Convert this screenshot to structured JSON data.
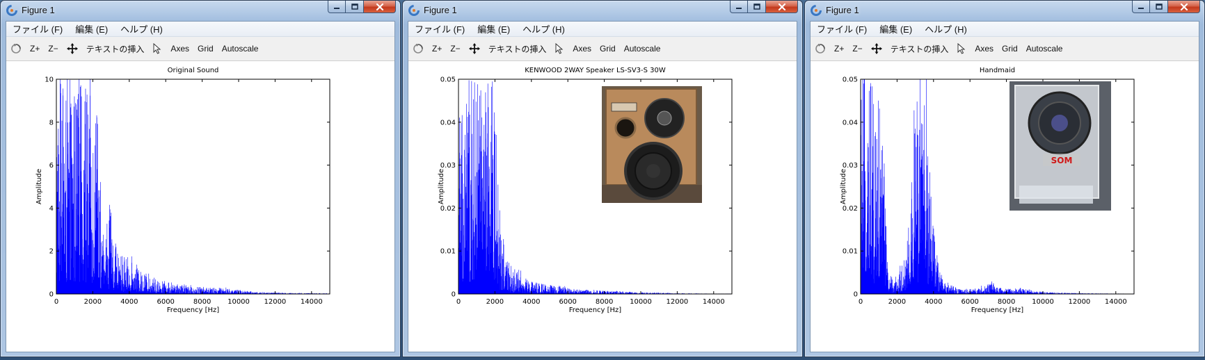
{
  "windows": [
    {
      "title": "Figure 1",
      "menu": [
        "ファイル (F)",
        "編集 (E)",
        "ヘルプ (H)"
      ],
      "toolbar": {
        "zoom_in": "Z+",
        "zoom_out": "Z−",
        "insert_text": "テキストの挿入",
        "axes": "Axes",
        "grid": "Grid",
        "autoscale": "Autoscale"
      },
      "chart_data": {
        "type": "line",
        "title": "Original Sound",
        "xlabel": "Frequency [Hz]",
        "ylabel": "Amplitude",
        "xlim": [
          0,
          15000
        ],
        "ylim": [
          0,
          10
        ],
        "xticks": [
          "0",
          "2000",
          "4000",
          "6000",
          "8000",
          "10000",
          "12000",
          "14000"
        ],
        "yticks": [
          "0",
          "2",
          "4",
          "6",
          "8",
          "10"
        ],
        "color": "#0000ff",
        "envelope": {
          "x": [
            0,
            100,
            300,
            500,
            700,
            900,
            1100,
            1300,
            1500,
            1700,
            1900,
            2100,
            2300,
            2500,
            2700,
            2900,
            3100,
            3300,
            3600,
            4000,
            4500,
            5000,
            5500,
            6000,
            6500,
            7000,
            7500,
            8000,
            8500,
            9000,
            9500,
            10000,
            11000,
            12000,
            13000,
            14000,
            15000
          ],
          "y": [
            10,
            10,
            10,
            10,
            10,
            10,
            10,
            10,
            10,
            10,
            9.5,
            10,
            7.5,
            3.0,
            3.5,
            4.4,
            2.5,
            2.0,
            1.9,
            1.6,
            1.1,
            1.0,
            0.7,
            0.6,
            0.45,
            0.45,
            0.35,
            0.35,
            0.3,
            0.3,
            0.25,
            0.2,
            0.1,
            0.07,
            0.05,
            0.04,
            0.03
          ]
        },
        "inset": null
      }
    },
    {
      "title": "Figure 1",
      "menu": [
        "ファイル (F)",
        "編集 (E)",
        "ヘルプ (H)"
      ],
      "toolbar": {
        "zoom_in": "Z+",
        "zoom_out": "Z−",
        "insert_text": "テキストの挿入",
        "axes": "Axes",
        "grid": "Grid",
        "autoscale": "Autoscale"
      },
      "chart_data": {
        "type": "line",
        "title": "KENWOOD 2WAY Speaker LS-SV3-S 30W",
        "xlabel": "Frequency [Hz]",
        "ylabel": "Amplitude",
        "xlim": [
          0,
          15000
        ],
        "ylim": [
          0,
          0.05
        ],
        "xticks": [
          "0",
          "2000",
          "4000",
          "6000",
          "8000",
          "10000",
          "12000",
          "14000"
        ],
        "yticks": [
          "0",
          "0.01",
          "0.02",
          "0.03",
          "0.04",
          "0.05"
        ],
        "color": "#0000ff",
        "envelope": {
          "x": [
            0,
            100,
            300,
            500,
            700,
            900,
            1100,
            1300,
            1500,
            1700,
            1900,
            2100,
            2300,
            2500,
            2700,
            2900,
            3100,
            3300,
            3600,
            4000,
            4500,
            5000,
            5500,
            6000,
            6500,
            7000,
            7500,
            8000,
            8500,
            9000,
            9500,
            10000,
            11000,
            12000,
            13000,
            14000,
            15000
          ],
          "y": [
            0.05,
            0.05,
            0.05,
            0.05,
            0.05,
            0.05,
            0.05,
            0.05,
            0.05,
            0.05,
            0.05,
            0.03,
            0.018,
            0.012,
            0.008,
            0.007,
            0.006,
            0.005,
            0.004,
            0.003,
            0.0025,
            0.002,
            0.0018,
            0.0015,
            0.0012,
            0.001,
            0.0009,
            0.0008,
            0.0007,
            0.0006,
            0.0005,
            0.0004,
            0.0003,
            0.0002,
            0.00015,
            0.0001,
            0.0001
          ]
        },
        "inset": {
          "name": "kenwood-speaker-photo"
        }
      }
    },
    {
      "title": "Figure 1",
      "menu": [
        "ファイル (F)",
        "編集 (E)",
        "ヘルプ (H)"
      ],
      "toolbar": {
        "zoom_in": "Z+",
        "zoom_out": "Z−",
        "insert_text": "テキストの挿入",
        "axes": "Axes",
        "grid": "Grid",
        "autoscale": "Autoscale"
      },
      "chart_data": {
        "type": "line",
        "title": "Handmaid",
        "xlabel": "Frequency [Hz]",
        "ylabel": "Amplitude",
        "xlim": [
          0,
          15000
        ],
        "ylim": [
          0,
          0.05
        ],
        "xticks": [
          "0",
          "2000",
          "4000",
          "6000",
          "8000",
          "10000",
          "12000",
          "14000"
        ],
        "yticks": [
          "0",
          "0.01",
          "0.02",
          "0.03",
          "0.04",
          "0.05"
        ],
        "color": "#0000ff",
        "envelope": {
          "x": [
            0,
            100,
            300,
            500,
            700,
            900,
            1100,
            1300,
            1500,
            1700,
            1900,
            2100,
            2300,
            2500,
            2700,
            2900,
            3100,
            3300,
            3500,
            3700,
            3900,
            4100,
            4300,
            4600,
            5000,
            5500,
            6000,
            6500,
            7000,
            7200,
            7500,
            8000,
            8500,
            9000,
            9500,
            10000,
            11000,
            12000,
            13000,
            14000,
            15000
          ],
          "y": [
            0.05,
            0.05,
            0.05,
            0.05,
            0.05,
            0.05,
            0.05,
            0.03,
            0.005,
            0.004,
            0.004,
            0.005,
            0.007,
            0.012,
            0.02,
            0.035,
            0.05,
            0.05,
            0.05,
            0.04,
            0.025,
            0.012,
            0.006,
            0.003,
            0.002,
            0.001,
            0.0012,
            0.0015,
            0.002,
            0.0035,
            0.0015,
            0.0012,
            0.0015,
            0.0013,
            0.0008,
            0.0005,
            0.0003,
            0.0002,
            0.00015,
            0.0001,
            0.0001
          ]
        },
        "inset": {
          "name": "handmade-speaker-photo",
          "logo_text": "SOM"
        }
      }
    }
  ]
}
